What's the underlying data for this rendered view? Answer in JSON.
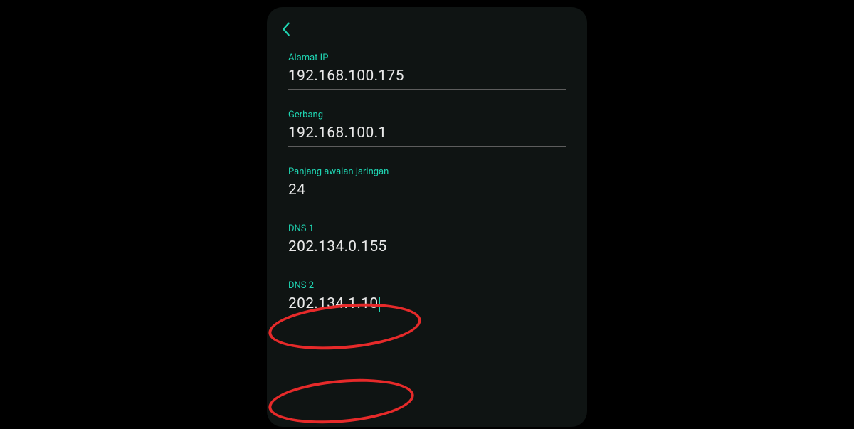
{
  "fields": {
    "ip": {
      "label": "Alamat IP",
      "value": "192.168.100.175"
    },
    "gateway": {
      "label": "Gerbang",
      "value": "192.168.100.1"
    },
    "prefix": {
      "label": "Panjang awalan jaringan",
      "value": "24"
    },
    "dns1": {
      "label": "DNS 1",
      "value": "202.134.0.155"
    },
    "dns2": {
      "label": "DNS 2",
      "value": "202.134.1.10"
    }
  }
}
